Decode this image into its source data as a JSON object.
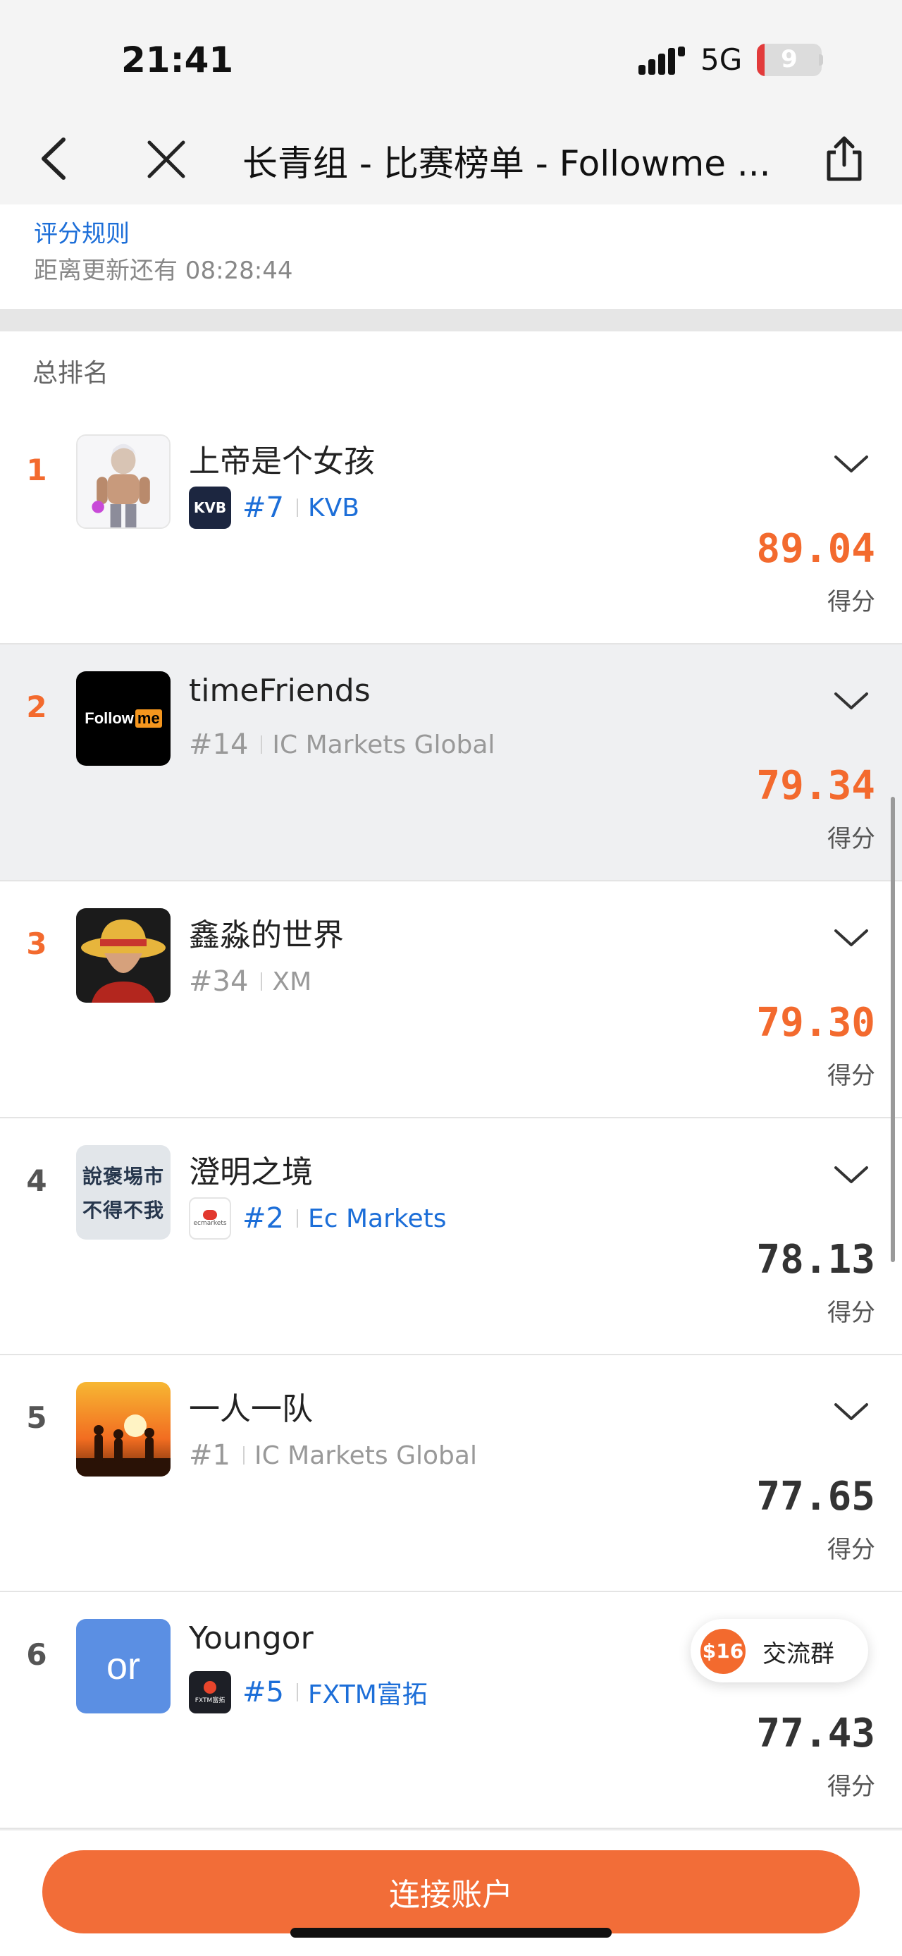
{
  "status_bar": {
    "time": "21:41",
    "network": "5G",
    "battery": "9",
    "battery_level": 0.09
  },
  "nav": {
    "title": "长青组 - 比赛榜单 - Followme ..."
  },
  "info": {
    "rules_link": "评分规则",
    "countdown": "距离更新还有 08:28:44"
  },
  "section": {
    "title": "总排名"
  },
  "rankings": [
    {
      "rank": "1",
      "name": "上帝是个女孩",
      "account": "#7",
      "broker": "KVB",
      "broker_logo": "KVB",
      "score": "89.04",
      "score_label": "得分"
    },
    {
      "rank": "2",
      "name": "timeFriends",
      "account": "#14",
      "broker": "IC Markets Global",
      "broker_logo": "",
      "score": "79.34",
      "score_label": "得分"
    },
    {
      "rank": "3",
      "name": "鑫淼的世界",
      "account": "#34",
      "broker": "XM",
      "broker_logo": "",
      "score": "79.30",
      "score_label": "得分"
    },
    {
      "rank": "4",
      "name": "澄明之境",
      "account": "#2",
      "broker": "Ec Markets",
      "broker_logo": "ecmarkets",
      "score": "78.13",
      "score_label": "得分"
    },
    {
      "rank": "5",
      "name": "一人一队",
      "account": "#1",
      "broker": "IC Markets Global",
      "broker_logo": "",
      "score": "77.65",
      "score_label": "得分"
    },
    {
      "rank": "6",
      "name": "Youngor",
      "account": "#5",
      "broker": "FXTM富拓",
      "broker_logo": "FXTM富拓",
      "score": "77.43",
      "score_label": "得分"
    }
  ],
  "avatars": {
    "followme_text_1": "Follow",
    "followme_text_2": "me",
    "calligraphy_1": "說褒埸市",
    "calligraphy_2": "不得不我",
    "initials": "or"
  },
  "chat": {
    "badge": "$16",
    "label": "交流群"
  },
  "bottom": {
    "connect_label": "连接账户"
  },
  "colors": {
    "accent": "#f36a2e",
    "link": "#1c6ed8",
    "button": "#f26d38"
  }
}
